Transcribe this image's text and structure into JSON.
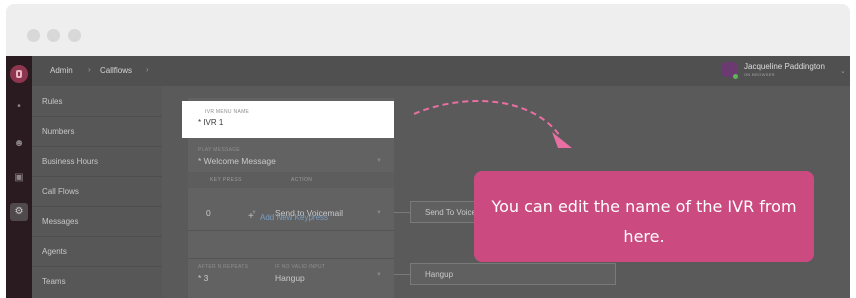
{
  "window": {
    "controls": [
      "close",
      "minimize",
      "maximize"
    ]
  },
  "breadcrumb": {
    "items": [
      "Admin",
      "Callflows"
    ]
  },
  "user": {
    "name": "Jacqueline Paddington",
    "status": "ON BROWSER"
  },
  "sidebar": {
    "items": [
      {
        "label": "Rules"
      },
      {
        "label": "Numbers"
      },
      {
        "label": "Business Hours"
      },
      {
        "label": "Call Flows"
      },
      {
        "label": "Messages"
      },
      {
        "label": "Agents"
      },
      {
        "label": "Teams"
      }
    ]
  },
  "rail": {
    "icons": [
      "phone-icon",
      "dialpad-icon",
      "people-icon",
      "contact-card-icon",
      "gear-icon"
    ]
  },
  "ivr": {
    "name_label": "IVR MENU NAME",
    "name_value": "* IVR 1",
    "message_label": "PLAY MESSAGE",
    "message_value": "* Welcome Message",
    "col_keypress": "KEY PRESS",
    "col_action": "ACTION",
    "row_key": "0",
    "row_action": "Send to Voicemail",
    "row_target": "Send To Voice",
    "add_keypress": "Add New Keypress",
    "repeat_label": "AFTER N REPEATS",
    "repeat_value": "* 3",
    "novalid_label": "IF NO VALID INPUT",
    "novalid_value": "Hangup",
    "novalid_target": "Hangup"
  },
  "tooltip": {
    "text": "You can edit the name of the IVR from here."
  },
  "colors": {
    "accent": "#cb4b80",
    "link": "#7a9ec2"
  }
}
